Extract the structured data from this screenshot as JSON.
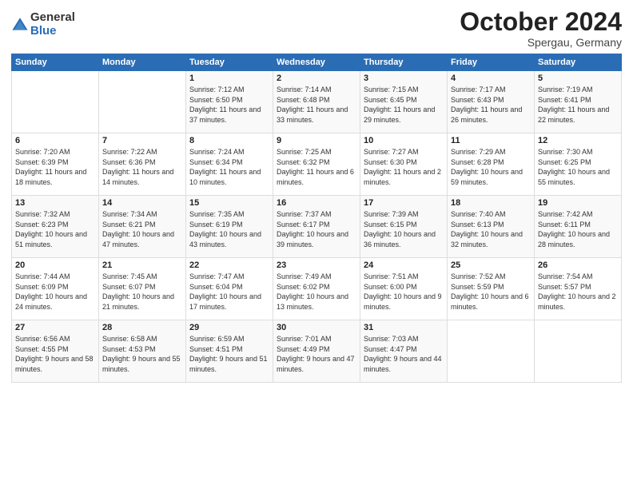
{
  "header": {
    "logo_general": "General",
    "logo_blue": "Blue",
    "month_title": "October 2024",
    "location": "Spergau, Germany"
  },
  "days_of_week": [
    "Sunday",
    "Monday",
    "Tuesday",
    "Wednesday",
    "Thursday",
    "Friday",
    "Saturday"
  ],
  "weeks": [
    [
      null,
      null,
      {
        "day": "1",
        "sunrise": "7:12 AM",
        "sunset": "6:50 PM",
        "daylight": "11 hours and 37 minutes."
      },
      {
        "day": "2",
        "sunrise": "7:14 AM",
        "sunset": "6:48 PM",
        "daylight": "11 hours and 33 minutes."
      },
      {
        "day": "3",
        "sunrise": "7:15 AM",
        "sunset": "6:45 PM",
        "daylight": "11 hours and 29 minutes."
      },
      {
        "day": "4",
        "sunrise": "7:17 AM",
        "sunset": "6:43 PM",
        "daylight": "11 hours and 26 minutes."
      },
      {
        "day": "5",
        "sunrise": "7:19 AM",
        "sunset": "6:41 PM",
        "daylight": "11 hours and 22 minutes."
      }
    ],
    [
      {
        "day": "6",
        "sunrise": "7:20 AM",
        "sunset": "6:39 PM",
        "daylight": "11 hours and 18 minutes."
      },
      {
        "day": "7",
        "sunrise": "7:22 AM",
        "sunset": "6:36 PM",
        "daylight": "11 hours and 14 minutes."
      },
      {
        "day": "8",
        "sunrise": "7:24 AM",
        "sunset": "6:34 PM",
        "daylight": "11 hours and 10 minutes."
      },
      {
        "day": "9",
        "sunrise": "7:25 AM",
        "sunset": "6:32 PM",
        "daylight": "11 hours and 6 minutes."
      },
      {
        "day": "10",
        "sunrise": "7:27 AM",
        "sunset": "6:30 PM",
        "daylight": "11 hours and 2 minutes."
      },
      {
        "day": "11",
        "sunrise": "7:29 AM",
        "sunset": "6:28 PM",
        "daylight": "10 hours and 59 minutes."
      },
      {
        "day": "12",
        "sunrise": "7:30 AM",
        "sunset": "6:25 PM",
        "daylight": "10 hours and 55 minutes."
      }
    ],
    [
      {
        "day": "13",
        "sunrise": "7:32 AM",
        "sunset": "6:23 PM",
        "daylight": "10 hours and 51 minutes."
      },
      {
        "day": "14",
        "sunrise": "7:34 AM",
        "sunset": "6:21 PM",
        "daylight": "10 hours and 47 minutes."
      },
      {
        "day": "15",
        "sunrise": "7:35 AM",
        "sunset": "6:19 PM",
        "daylight": "10 hours and 43 minutes."
      },
      {
        "day": "16",
        "sunrise": "7:37 AM",
        "sunset": "6:17 PM",
        "daylight": "10 hours and 39 minutes."
      },
      {
        "day": "17",
        "sunrise": "7:39 AM",
        "sunset": "6:15 PM",
        "daylight": "10 hours and 36 minutes."
      },
      {
        "day": "18",
        "sunrise": "7:40 AM",
        "sunset": "6:13 PM",
        "daylight": "10 hours and 32 minutes."
      },
      {
        "day": "19",
        "sunrise": "7:42 AM",
        "sunset": "6:11 PM",
        "daylight": "10 hours and 28 minutes."
      }
    ],
    [
      {
        "day": "20",
        "sunrise": "7:44 AM",
        "sunset": "6:09 PM",
        "daylight": "10 hours and 24 minutes."
      },
      {
        "day": "21",
        "sunrise": "7:45 AM",
        "sunset": "6:07 PM",
        "daylight": "10 hours and 21 minutes."
      },
      {
        "day": "22",
        "sunrise": "7:47 AM",
        "sunset": "6:04 PM",
        "daylight": "10 hours and 17 minutes."
      },
      {
        "day": "23",
        "sunrise": "7:49 AM",
        "sunset": "6:02 PM",
        "daylight": "10 hours and 13 minutes."
      },
      {
        "day": "24",
        "sunrise": "7:51 AM",
        "sunset": "6:00 PM",
        "daylight": "10 hours and 9 minutes."
      },
      {
        "day": "25",
        "sunrise": "7:52 AM",
        "sunset": "5:59 PM",
        "daylight": "10 hours and 6 minutes."
      },
      {
        "day": "26",
        "sunrise": "7:54 AM",
        "sunset": "5:57 PM",
        "daylight": "10 hours and 2 minutes."
      }
    ],
    [
      {
        "day": "27",
        "sunrise": "6:56 AM",
        "sunset": "4:55 PM",
        "daylight": "9 hours and 58 minutes."
      },
      {
        "day": "28",
        "sunrise": "6:58 AM",
        "sunset": "4:53 PM",
        "daylight": "9 hours and 55 minutes."
      },
      {
        "day": "29",
        "sunrise": "6:59 AM",
        "sunset": "4:51 PM",
        "daylight": "9 hours and 51 minutes."
      },
      {
        "day": "30",
        "sunrise": "7:01 AM",
        "sunset": "4:49 PM",
        "daylight": "9 hours and 47 minutes."
      },
      {
        "day": "31",
        "sunrise": "7:03 AM",
        "sunset": "4:47 PM",
        "daylight": "9 hours and 44 minutes."
      },
      null,
      null
    ]
  ]
}
